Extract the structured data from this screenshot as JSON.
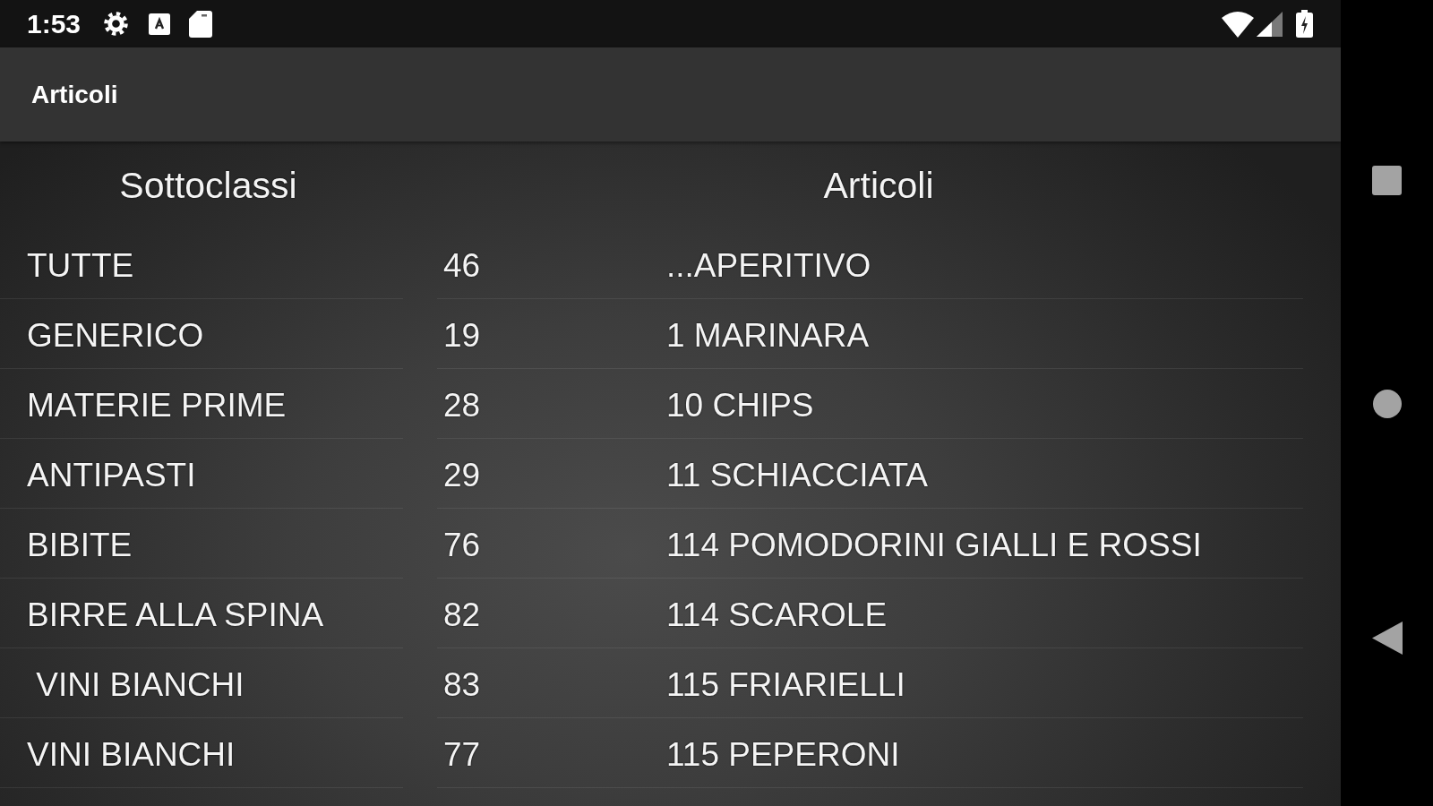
{
  "status_bar": {
    "time": "1:53"
  },
  "app_bar": {
    "title": "Articoli"
  },
  "subclasses": {
    "heading": "Sottoclassi",
    "items": [
      "TUTTE",
      "GENERICO",
      "MATERIE PRIME",
      "ANTIPASTI",
      "BIBITE",
      "BIRRE ALLA SPINA",
      " VINI BIANCHI",
      "VINI BIANCHI"
    ]
  },
  "articles": {
    "heading": "Articoli",
    "rows": [
      {
        "number": "46",
        "name": "...APERITIVO"
      },
      {
        "number": "19",
        "name": "1 MARINARA"
      },
      {
        "number": "28",
        "name": "10 CHIPS"
      },
      {
        "number": "29",
        "name": "11 SCHIACCIATA"
      },
      {
        "number": "76",
        "name": "114 POMODORINI GIALLI E ROSSI"
      },
      {
        "number": "82",
        "name": "114 SCAROLE"
      },
      {
        "number": "83",
        "name": "115 FRIARIELLI"
      },
      {
        "number": "77",
        "name": "115 PEPERONI"
      }
    ]
  }
}
